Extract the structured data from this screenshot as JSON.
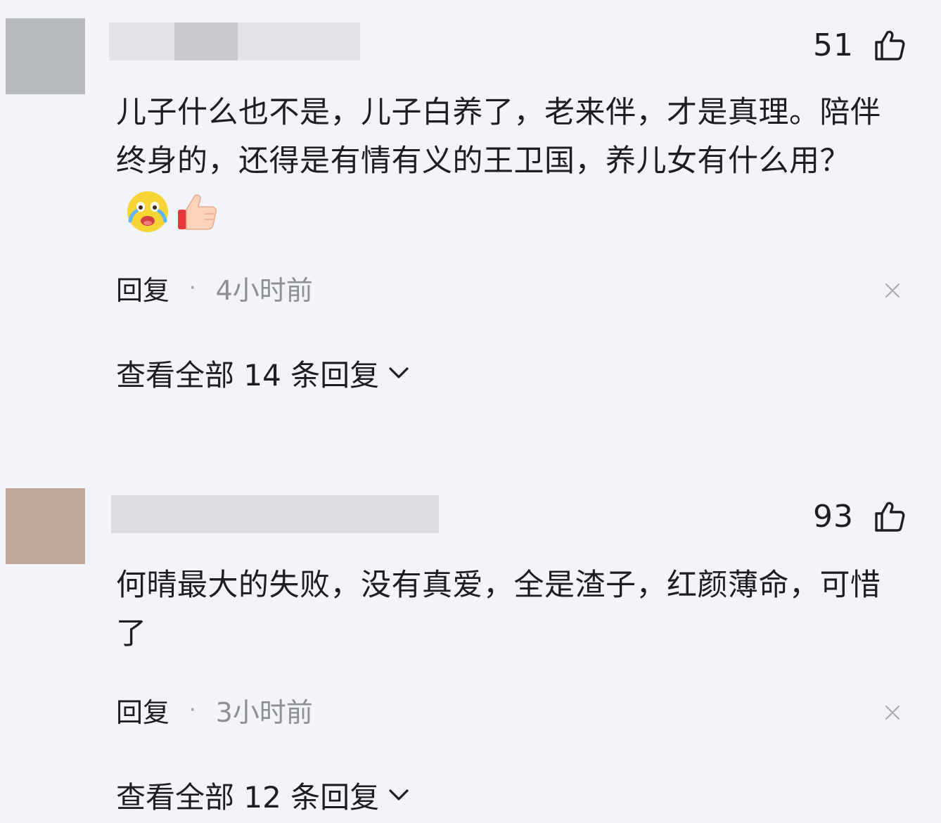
{
  "comments": [
    {
      "avatar_color": "#b6b9be",
      "likes": "51",
      "text": "儿子什么也不是，儿子白养了，老来伴，才是真理。陪伴终身的，还得是有情有义的王卫国，养儿女有什么用？",
      "emojis": [
        "crying-face",
        "thumbs-up"
      ],
      "reply_label": "回复",
      "dot": "·",
      "time": "4小时前",
      "view_all": "查看全部 14 条回复"
    },
    {
      "avatar_color": "#bfa99a",
      "likes": "93",
      "text": "何晴最大的失败，没有真爱，全是渣子，红颜薄命，可惜了",
      "emojis": [],
      "reply_label": "回复",
      "dot": "·",
      "time": "3小时前",
      "view_all": "查看全部 12 条回复"
    }
  ]
}
